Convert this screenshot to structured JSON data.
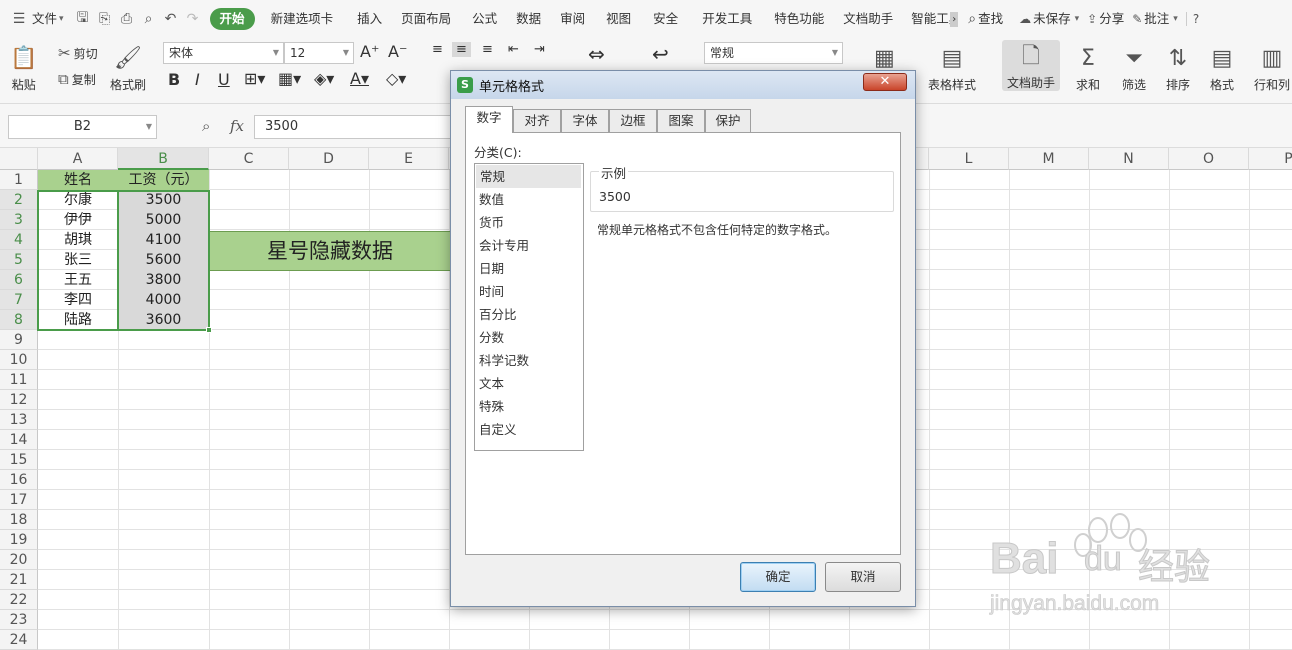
{
  "menu": {
    "file": "文件",
    "tabs": [
      "开始",
      "新建选项卡",
      "插入",
      "页面布局",
      "公式",
      "数据",
      "审阅",
      "视图",
      "安全",
      "开发工具",
      "特色功能",
      "文档助手",
      "智能工具"
    ],
    "active_index": 0,
    "search": "查找",
    "unsaved": "未保存",
    "share": "分享",
    "comment": "批注"
  },
  "ribbon": {
    "paste": "粘贴",
    "cut": "剪切",
    "copy": "复制",
    "format_painter": "格式刷",
    "font_name": "宋体",
    "font_size": "12",
    "number_format": "常规",
    "table_style": "表格样式",
    "doc_assistant": "文档助手",
    "sum": "求和",
    "filter": "筛选",
    "sort": "排序",
    "format": "格式",
    "row_col": "行和列"
  },
  "formula_bar": {
    "name_box": "B2",
    "fx": "fx",
    "value": "3500"
  },
  "sheet": {
    "columns": [
      "A",
      "B",
      "C",
      "D",
      "E",
      "L",
      "M",
      "N",
      "O",
      "P"
    ],
    "rows": [
      "1",
      "2",
      "3",
      "4",
      "5",
      "6",
      "7",
      "8",
      "9",
      "10",
      "11",
      "12",
      "13",
      "14",
      "15",
      "16",
      "17",
      "18",
      "19",
      "20",
      "21",
      "22",
      "23",
      "24"
    ],
    "header": [
      "姓名",
      "工资（元）"
    ],
    "names": [
      "尔康",
      "伊伊",
      "胡琪",
      "张三",
      "王五",
      "李四",
      "陆路"
    ],
    "salaries": [
      "3500",
      "5000",
      "4100",
      "5600",
      "3800",
      "4000",
      "3600"
    ],
    "banner": "星号隐藏数据"
  },
  "dialog": {
    "title": "单元格格式",
    "close": "✕",
    "tabs": [
      "数字",
      "对齐",
      "字体",
      "边框",
      "图案",
      "保护"
    ],
    "category_label": "分类(C):",
    "categories": [
      "常规",
      "数值",
      "货币",
      "会计专用",
      "日期",
      "时间",
      "百分比",
      "分数",
      "科学记数",
      "文本",
      "特殊",
      "自定义"
    ],
    "sample_label": "示例",
    "sample_value": "3500",
    "description": "常规单元格格式不包含任何特定的数字格式。",
    "ok": "确定",
    "cancel": "取消"
  },
  "watermark": {
    "brand": "Bai",
    "brand2": "du",
    "cn": "经验",
    "url": "jingyan.baidu.com"
  },
  "colors": {
    "accent_green": "#4a9c4a",
    "header_fill": "#a9d18e",
    "selection_fill": "#d9d9d9"
  }
}
